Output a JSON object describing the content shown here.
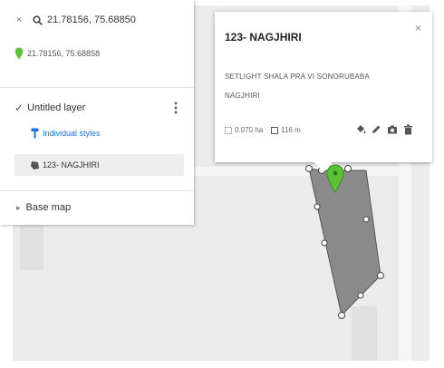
{
  "search": {
    "query": "21.78156, 75.68850",
    "result_coords": "21.78156, 75.68858"
  },
  "layer": {
    "name": "Untitled layer",
    "style_link": "Individual styles",
    "feature_name": "123- NAGJHIRI"
  },
  "base_map": {
    "label": "Base map"
  },
  "popup": {
    "title": "123- NAGJHIRI",
    "description_line1": "SETLIGHT SHALA PRA VI SONORUBABA",
    "description_line2": "NAGJHIRI",
    "area": "0.070 ha",
    "perimeter": "116 m"
  },
  "colors": {
    "marker": "#5bc236",
    "polygon_fill": "#7f7f7f",
    "link": "#1a73e8"
  },
  "icons": [
    "close-icon",
    "search-icon",
    "location-pin-icon",
    "checkbox-icon",
    "more-vert-icon",
    "paint-roller-icon",
    "polygon-icon",
    "base-map-icon",
    "paint-bucket-icon",
    "pencil-icon",
    "camera-icon",
    "trash-icon",
    "area-icon",
    "perimeter-icon"
  ]
}
